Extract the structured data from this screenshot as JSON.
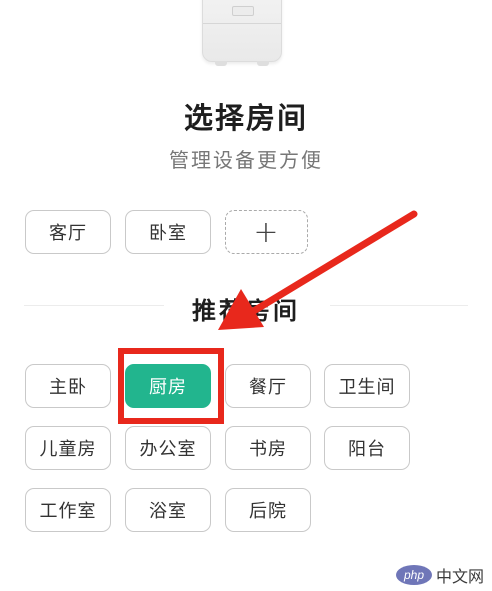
{
  "header": {
    "title": "选择房间",
    "subtitle": "管理设备更方便"
  },
  "my_rooms": {
    "items": [
      {
        "label": "客厅"
      },
      {
        "label": "卧室"
      }
    ],
    "add_label": "+"
  },
  "recommended": {
    "title": "推荐房间",
    "items": [
      {
        "label": "主卧",
        "selected": false
      },
      {
        "label": "厨房",
        "selected": true
      },
      {
        "label": "餐厅",
        "selected": false
      },
      {
        "label": "卫生间",
        "selected": false
      },
      {
        "label": "儿童房",
        "selected": false
      },
      {
        "label": "办公室",
        "selected": false
      },
      {
        "label": "书房",
        "selected": false
      },
      {
        "label": "阳台",
        "selected": false
      },
      {
        "label": "工作室",
        "selected": false
      },
      {
        "label": "浴室",
        "selected": false
      },
      {
        "label": "后院",
        "selected": false
      }
    ]
  },
  "annotation": {
    "arrow_color": "#e8281c",
    "box_color": "#e8281c"
  },
  "watermark": {
    "badge": "php",
    "text": "中文网"
  },
  "colors": {
    "accent": "#22b58e",
    "chip_border": "#c9c9c9"
  }
}
